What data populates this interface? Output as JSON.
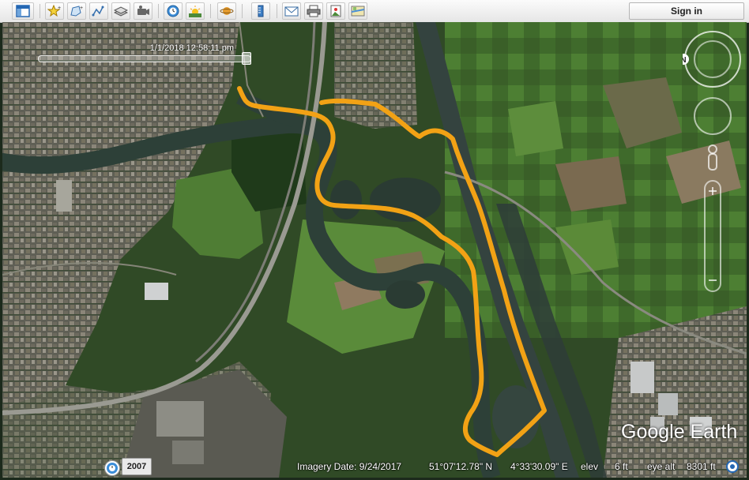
{
  "toolbar": {
    "buttons": [
      {
        "name": "sidebar-toggle-button",
        "icon": "sidebar-icon"
      },
      {
        "name": "add-placemark-button",
        "icon": "placemark-icon"
      },
      {
        "name": "add-polygon-button",
        "icon": "polygon-icon"
      },
      {
        "name": "add-path-button",
        "icon": "path-icon"
      },
      {
        "name": "add-overlay-button",
        "icon": "image-overlay-icon"
      },
      {
        "name": "record-tour-button",
        "icon": "tour-icon"
      },
      {
        "name": "historical-imagery-button",
        "icon": "clock-icon"
      },
      {
        "name": "sunlight-button",
        "icon": "sun-icon"
      },
      {
        "name": "switch-planet-button",
        "icon": "planet-icon"
      },
      {
        "name": "ruler-button",
        "icon": "ruler-icon"
      },
      {
        "name": "email-button",
        "icon": "email-icon"
      },
      {
        "name": "print-button",
        "icon": "printer-icon"
      },
      {
        "name": "save-image-button",
        "icon": "save-image-icon"
      },
      {
        "name": "view-in-maps-button",
        "icon": "maps-icon"
      }
    ],
    "sign_in_label": "Sign in"
  },
  "time_slider": {
    "date_time": "1/1/2018  12:58:11 pm"
  },
  "navigation": {
    "north_label": "N"
  },
  "status": {
    "history_year": "2007",
    "imagery_date": "Imagery Date: 9/24/2017",
    "latitude": "51°07'12.78\" N",
    "longitude": "4°33'30.09\" E",
    "elev_label": "elev",
    "elev_value": "6 ft",
    "eye_alt_label": "eye alt",
    "eye_alt_value": "8301 ft"
  },
  "branding": {
    "logo_text": "Google Earth"
  },
  "colors": {
    "track": "#f2a215",
    "water": "#2d4038",
    "canal": "#34433f",
    "field": "#4f7a34",
    "urban": "#8a8878"
  }
}
